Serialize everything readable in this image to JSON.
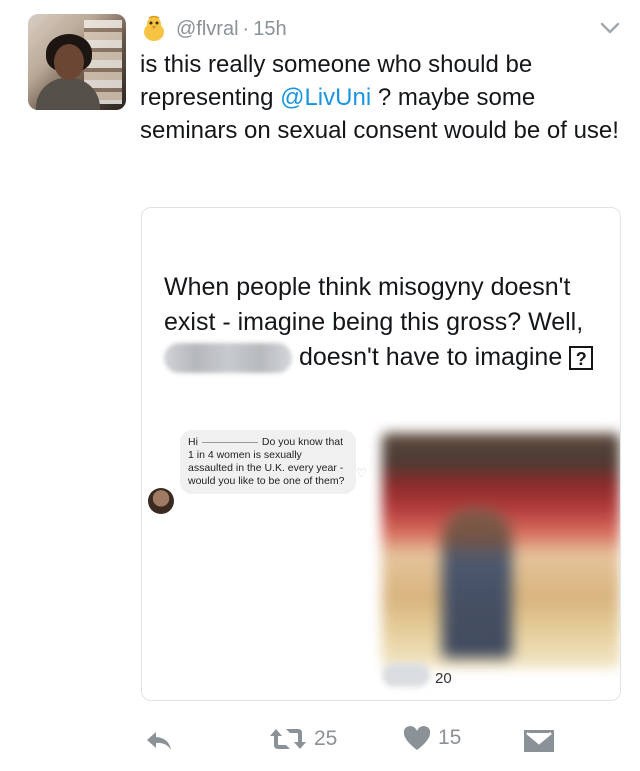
{
  "tweet": {
    "handle": "@flvral",
    "separator": "·",
    "time": "15h",
    "text_part1": "is this really someone who should be representing ",
    "mention": "@LivUni",
    "text_part2": " ? maybe some seminars on sexual consent would be of use!"
  },
  "card": {
    "text_before": "When people think misogyny doesn't exist - imagine being this gross? Well, ",
    "text_after": " doesn't have to imagine ",
    "box_symbol": "?",
    "chat": {
      "greeting": "Hi",
      "message": "Do you know that 1 in 4 women is sexually assaulted in the U.K. every year - would you like to be one of them?"
    },
    "photo_count": "20"
  },
  "actions": {
    "retweets": "25",
    "likes": "15"
  },
  "colors": {
    "mention": "#1b95e0",
    "meta": "#8a9197",
    "card_border": "#dfe3e7"
  },
  "icons": [
    "chick-emoji-icon",
    "chevron-down-icon",
    "reply-icon",
    "retweet-icon",
    "heart-icon",
    "direct-message-icon"
  ]
}
